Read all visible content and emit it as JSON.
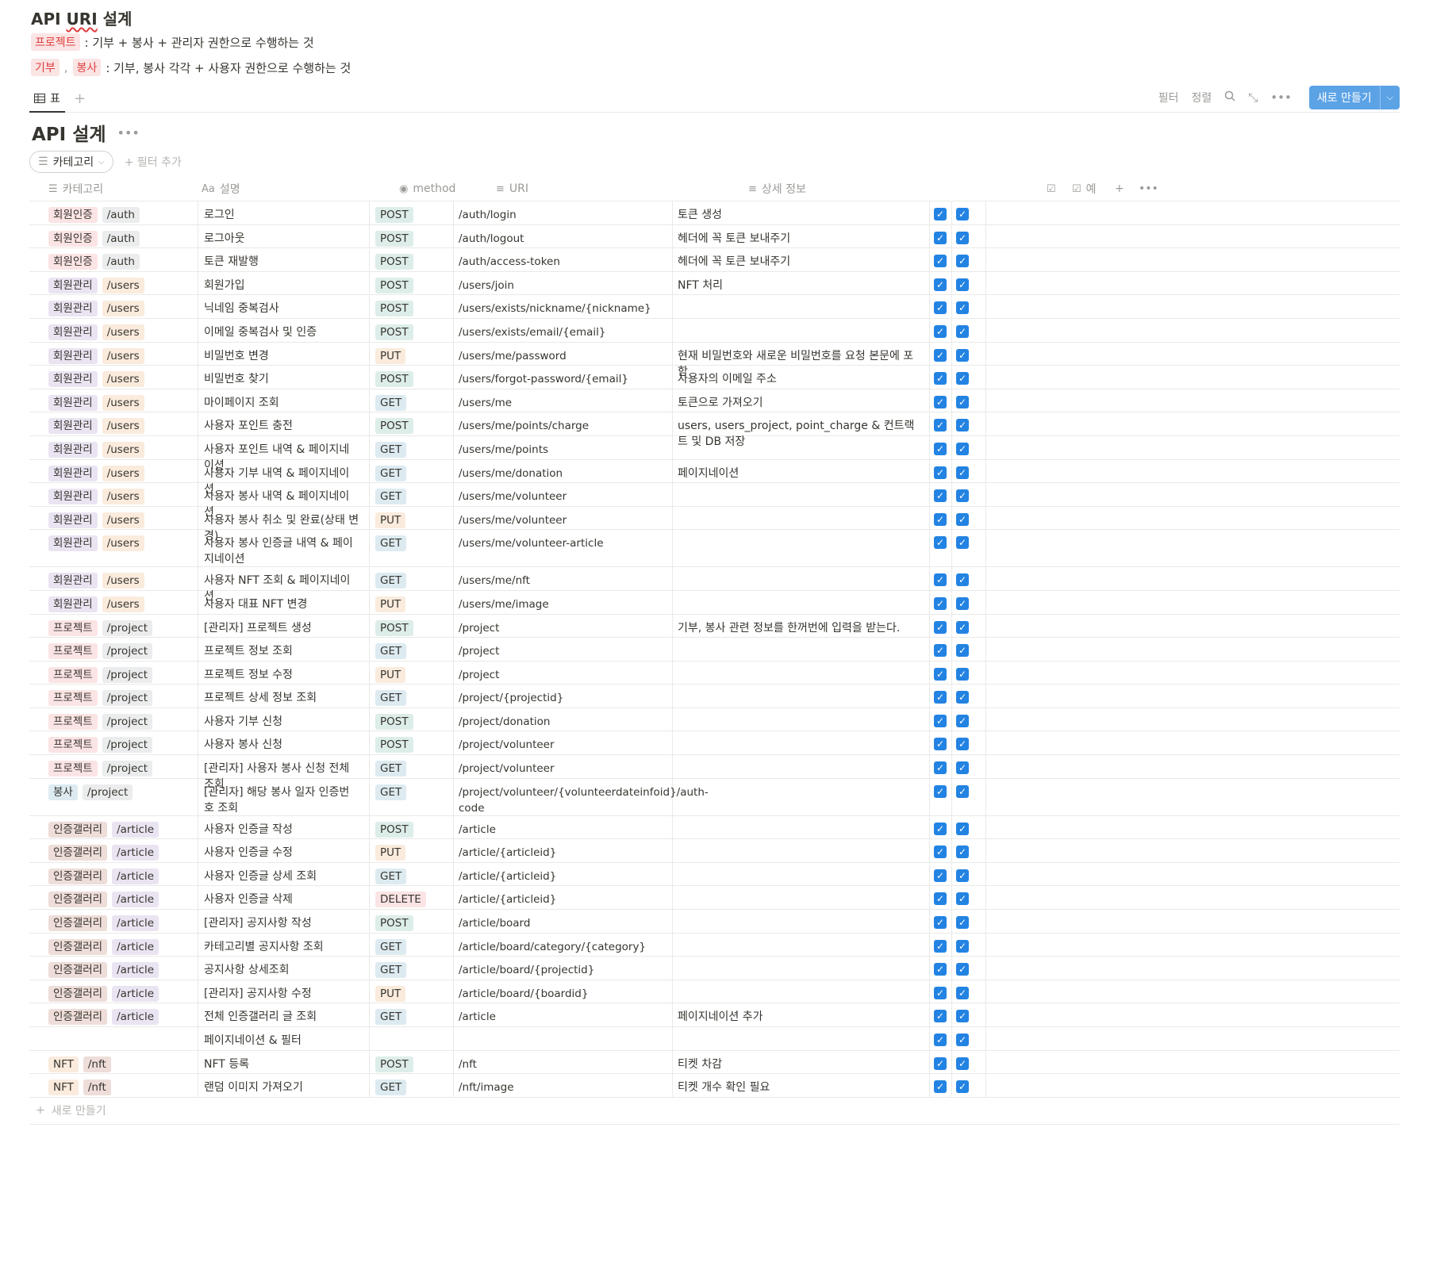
{
  "page": {
    "title_pre": "API ",
    "title_uri": "URI",
    "title_post": " 설계",
    "line1_tag": "프로젝트",
    "line1_text": ": 기부 + 봉사 + 관리자 권한으로 수행하는 것",
    "line2_tag1": "기부",
    "line2_comma": ",",
    "line2_tag2": "봉사",
    "line2_text": ": 기부, 봉사 각각 + 사용자 권한으로 수행하는 것"
  },
  "view": {
    "tab_label": "표",
    "filter_label": "필터",
    "sort_label": "정렬",
    "new_label": "새로 만들기"
  },
  "database": {
    "title": "API 설계",
    "filter_pill": "카테고리",
    "add_filter": "필터 추가",
    "new_row_label": "새로 만들기"
  },
  "columns": {
    "category": "카테고리",
    "description": "설명",
    "description_prefix": "Aa",
    "method": "method",
    "uri": "URI",
    "detail": "상세 정보",
    "check2": "예"
  },
  "rows": [
    {
      "cat": "회원인증",
      "res": "/auth",
      "desc": "로그인",
      "method": "POST",
      "uri": "/auth/login",
      "detail": "토큰 생성"
    },
    {
      "cat": "회원인증",
      "res": "/auth",
      "desc": "로그아웃",
      "method": "POST",
      "uri": "/auth/logout",
      "detail": "헤더에 꼭 토큰 보내주기"
    },
    {
      "cat": "회원인증",
      "res": "/auth",
      "desc": "토큰 재발행",
      "method": "POST",
      "uri": "/auth/access-token",
      "detail": "헤더에 꼭 토큰 보내주기"
    },
    {
      "cat": "회원관리",
      "res": "/users",
      "desc": "회원가입",
      "method": "POST",
      "uri": "/users/join",
      "detail": "NFT 처리"
    },
    {
      "cat": "회원관리",
      "res": "/users",
      "desc": "닉네임 중복검사",
      "method": "POST",
      "uri": "/users/exists/nickname/{nickname}",
      "detail": ""
    },
    {
      "cat": "회원관리",
      "res": "/users",
      "desc": "이메일 중복검사 및 인증",
      "method": "POST",
      "uri": "/users/exists/email/{email}",
      "detail": ""
    },
    {
      "cat": "회원관리",
      "res": "/users",
      "desc": "비밀번호 변경",
      "method": "PUT",
      "uri": "/users/me/password",
      "detail": "현재 비밀번호와 새로운 비밀번호를 요청 본문에 포함"
    },
    {
      "cat": "회원관리",
      "res": "/users",
      "desc": "비밀번호 찾기",
      "method": "POST",
      "uri": "/users/forgot-password/{email}",
      "detail": "사용자의 이메일 주소"
    },
    {
      "cat": "회원관리",
      "res": "/users",
      "desc": "마이페이지 조회",
      "method": "GET",
      "uri": "/users/me",
      "detail": "토큰으로 가져오기"
    },
    {
      "cat": "회원관리",
      "res": "/users",
      "desc": "사용자 포인트 충전",
      "method": "POST",
      "uri": "/users/me/points/charge",
      "detail": "users, users_project, point_charge & 컨트랙트 및 DB 저장"
    },
    {
      "cat": "회원관리",
      "res": "/users",
      "desc": "사용자 포인트 내역 & 페이지네이션",
      "method": "GET",
      "uri": "/users/me/points",
      "detail": ""
    },
    {
      "cat": "회원관리",
      "res": "/users",
      "desc": "사용자 기부 내역 & 페이지네이션",
      "method": "GET",
      "uri": "/users/me/donation",
      "detail": "페이지네이션"
    },
    {
      "cat": "회원관리",
      "res": "/users",
      "desc": "사용자 봉사 내역 & 페이지네이션",
      "method": "GET",
      "uri": "/users/me/volunteer",
      "detail": ""
    },
    {
      "cat": "회원관리",
      "res": "/users",
      "desc": "사용자 봉사 취소 및 완료(상태 변경)",
      "method": "PUT",
      "uri": "/users/me/volunteer",
      "detail": ""
    },
    {
      "cat": "회원관리",
      "res": "/users",
      "desc": "사용자 봉사 인증글 내역 & 페이지네이션",
      "method": "GET",
      "uri": "/users/me/volunteer-article",
      "detail": ""
    },
    {
      "cat": "회원관리",
      "res": "/users",
      "desc": "사용자 NFT 조회 & 페이지네이션",
      "method": "GET",
      "uri": "/users/me/nft",
      "detail": ""
    },
    {
      "cat": "회원관리",
      "res": "/users",
      "desc": "사용자 대표 NFT 변경",
      "method": "PUT",
      "uri": "/users/me/image",
      "detail": ""
    },
    {
      "cat": "프로젝트",
      "res": "/project",
      "desc": "[관리자] 프로젝트 생성",
      "method": "POST",
      "uri": "/project",
      "detail": "기부, 봉사 관련 정보를 한꺼번에 입력을 받는다."
    },
    {
      "cat": "프로젝트",
      "res": "/project",
      "desc": "프로젝트 정보 조회",
      "method": "GET",
      "uri": "/project",
      "detail": ""
    },
    {
      "cat": "프로젝트",
      "res": "/project",
      "desc": "프로젝트 정보 수정",
      "method": "PUT",
      "uri": "/project",
      "detail": ""
    },
    {
      "cat": "프로젝트",
      "res": "/project",
      "desc": "프로젝트 상세 정보 조회",
      "method": "GET",
      "uri": "/project/{projectid}",
      "detail": ""
    },
    {
      "cat": "프로젝트",
      "res": "/project",
      "desc": "사용자 기부 신청",
      "method": "POST",
      "uri": "/project/donation",
      "detail": ""
    },
    {
      "cat": "프로젝트",
      "res": "/project",
      "desc": "사용자 봉사 신청",
      "method": "POST",
      "uri": "/project/volunteer",
      "detail": ""
    },
    {
      "cat": "프로젝트",
      "res": "/project",
      "desc": "[관리자] 사용자 봉사 신청 전체 조회",
      "method": "GET",
      "uri": "/project/volunteer",
      "detail": ""
    },
    {
      "cat": "봉사",
      "res": "/project",
      "desc": "[관리자] 해당 봉사 일자 인증번호 조회",
      "method": "GET",
      "uri": "/project/volunteer/{volunteerdateinfoid}/auth-code",
      "detail": ""
    },
    {
      "cat": "인증갤러리",
      "res": "/article",
      "desc": "사용자 인증글 작성",
      "method": "POST",
      "uri": "/article",
      "detail": ""
    },
    {
      "cat": "인증갤러리",
      "res": "/article",
      "desc": "사용자 인증글 수정",
      "method": "PUT",
      "uri": "/article/{articleid}",
      "detail": ""
    },
    {
      "cat": "인증갤러리",
      "res": "/article",
      "desc": "사용자 인증글 상세 조회",
      "method": "GET",
      "uri": "/article/{articleid}",
      "detail": ""
    },
    {
      "cat": "인증갤러리",
      "res": "/article",
      "desc": "사용자 인증글 삭제",
      "method": "DELETE",
      "uri": "/article/{articleid}",
      "detail": ""
    },
    {
      "cat": "인증갤러리",
      "res": "/article",
      "desc": "[관리자] 공지사항 작성",
      "method": "POST",
      "uri": "/article/board",
      "detail": ""
    },
    {
      "cat": "인증갤러리",
      "res": "/article",
      "desc": "카테고리별 공지사항 조회",
      "method": "GET",
      "uri": "/article/board/category/{category}",
      "detail": ""
    },
    {
      "cat": "인증갤러리",
      "res": "/article",
      "desc": "공지사항 상세조회",
      "method": "GET",
      "uri": "/article/board/{projectid}",
      "detail": ""
    },
    {
      "cat": "인증갤러리",
      "res": "/article",
      "desc": "[관리자] 공지사항 수정",
      "method": "PUT",
      "uri": "/article/board/{boardid}",
      "detail": ""
    },
    {
      "cat": "인증갤러리",
      "res": "/article",
      "desc": "전체 인증갤러리 글 조회",
      "method": "GET",
      "uri": "/article",
      "detail": "페이지네이션 추가"
    },
    {
      "cat": "",
      "res": "",
      "desc": "페이지네이션 & 필터",
      "method": "",
      "uri": "",
      "detail": ""
    },
    {
      "cat": "NFT",
      "res": "/nft",
      "desc": "NFT 등록",
      "method": "POST",
      "uri": "/nft",
      "detail": "티켓 차감"
    },
    {
      "cat": "NFT",
      "res": "/nft",
      "desc": "랜덤 이미지 가져오기",
      "method": "GET",
      "uri": "/nft/image",
      "detail": "티켓 개수 확인 필요"
    }
  ],
  "colors": {
    "accent": "#2383e2",
    "new_button": "#5ca3e6",
    "border": "#e9e9e7"
  }
}
